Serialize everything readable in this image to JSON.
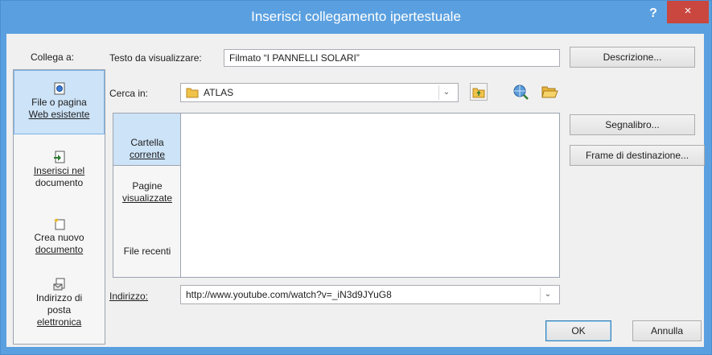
{
  "window": {
    "title": "Inserisci collegamento ipertestuale",
    "help": "?",
    "close": "×"
  },
  "link_to": {
    "label": "Collega a:",
    "items": [
      {
        "line1": "File o pagina",
        "line2": "Web esistente",
        "icon": "web-page-icon"
      },
      {
        "line1": "Inserisci nel",
        "line2": "documento",
        "icon": "document-place-icon"
      },
      {
        "line1": "Crea nuovo",
        "line2": "documento",
        "icon": "new-document-icon"
      },
      {
        "line1": "Indirizzo di",
        "line2": "posta",
        "line3": "elettronica",
        "icon": "email-icon"
      }
    ]
  },
  "display_text": {
    "label": "Testo da visualizzare:",
    "value": "Filmato “I PANNELLI SOLARI”"
  },
  "look_in": {
    "label": "Cerca in:",
    "value": "ATLAS"
  },
  "tabs": [
    {
      "line1": "Cartella",
      "line2": "corrente"
    },
    {
      "line1": "Pagine",
      "line2": "visualizzate"
    },
    {
      "line1": "File recenti"
    }
  ],
  "address": {
    "label": "Indirizzo:",
    "value": "http://www.youtube.com/watch?v=_iN3d9JYuG8"
  },
  "buttons": {
    "description": "Descrizione...",
    "bookmark": "Segnalibro...",
    "target_frame": "Frame di destinazione...",
    "ok": "OK",
    "cancel": "Annulla"
  },
  "colors": {
    "title_bar": "#5aa0e0",
    "close": "#c9473f",
    "selection": "#cde3f7"
  }
}
